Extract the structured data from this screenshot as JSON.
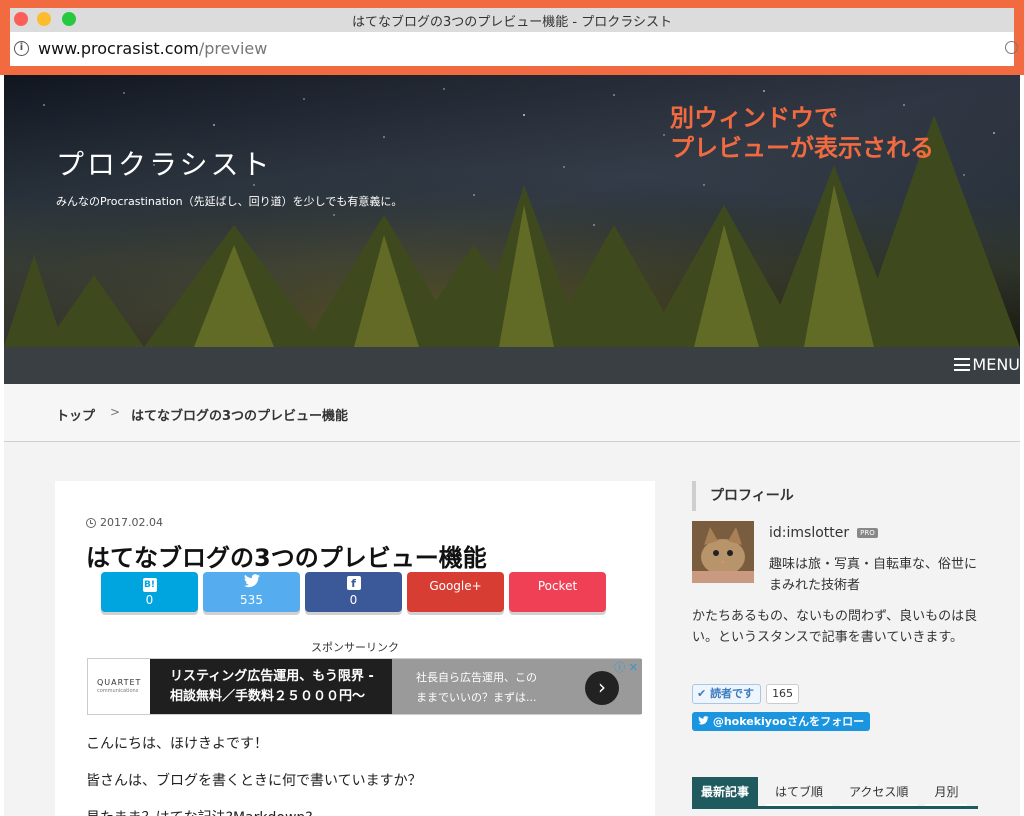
{
  "window": {
    "title": "はてなブログの3つのプレビュー機能 - プロクラシスト",
    "url_host": "www.procrasist.com",
    "url_path": "/preview"
  },
  "header": {
    "site_title": "プロクラシスト",
    "tagline": "みんなのProcrastination（先延ばし、回り道）を少しでも有意義に。",
    "annotation_line1": "別ウィンドウで",
    "annotation_line2": "プレビューが表示される",
    "annotation_color": "#f26a3f"
  },
  "menu": {
    "label": "MENU"
  },
  "breadcrumb": {
    "home": "トップ",
    "separator": ">",
    "current": "はてなブログの3つのプレビュー機能"
  },
  "article": {
    "date": "2017.02.04",
    "title": "はてなブログの3つのプレビュー機能",
    "share": [
      {
        "service": "hatena-bookmark",
        "icon": "B!",
        "count": "0"
      },
      {
        "service": "twitter",
        "icon": "twitter-bird-icon",
        "count": "535"
      },
      {
        "service": "facebook",
        "icon": "f",
        "count": "0"
      },
      {
        "service": "google-plus",
        "label": "Google+"
      },
      {
        "service": "pocket",
        "label": "Pocket"
      }
    ],
    "sponsor_label": "スポンサーリンク",
    "ad": {
      "logo_text": "QUARTET",
      "logo_sub": "communications",
      "main_line1": "リスティング広告運用、もう限界 -",
      "main_line2": "相談無料／手数料２５０００円〜",
      "sub_line1": "社長自ら広告運用、この",
      "sub_line2": "ままでいいの？まずは...",
      "arrow": "›",
      "choice": "ⓘ ✕"
    },
    "paragraphs": [
      "こんにちは、ほけきよです！",
      "皆さんは、ブログを書くときに何で書いていますか？",
      "見たまま？はてな記法?Markdown?"
    ]
  },
  "sidebar": {
    "heading": "プロフィール",
    "profile_id": "id:imslotter",
    "pro_badge": "PRO",
    "profile_tagline": "趣味は旅・写真・自転車な、俗世にまみれた技術者",
    "profile_desc": "かたちあるもの、ないもの問わず、良いものは良い。というスタンスで記事を書いていきます。",
    "reader_button": "読者です",
    "reader_count": "165",
    "follow_button": "@hokekiyooさんをフォロー",
    "tabs": [
      "最新記事",
      "はてブ順",
      "アクセス順",
      "月別"
    ],
    "active_tab": "最新記事"
  }
}
